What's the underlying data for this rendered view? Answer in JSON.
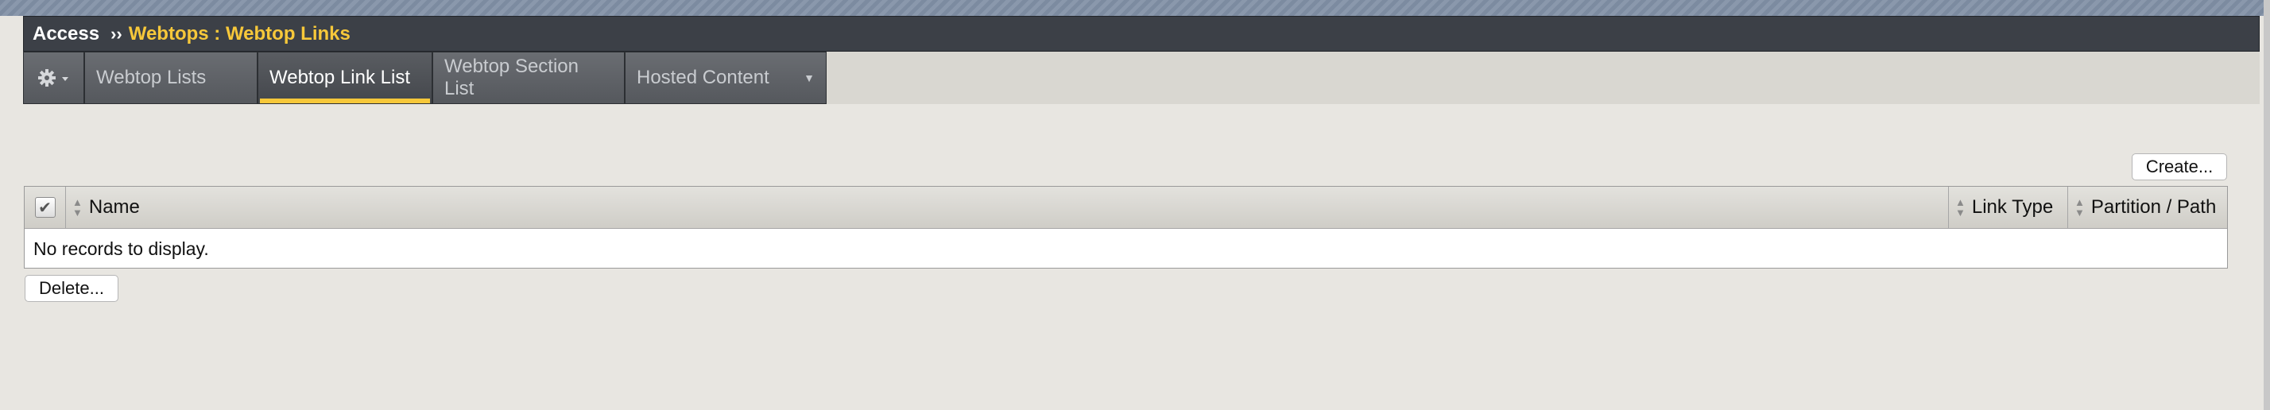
{
  "breadcrumb": {
    "root": "Access",
    "separator": "››",
    "current": "Webtops : Webtop Links"
  },
  "tabs": {
    "gear_icon": "gear-icon",
    "items": [
      {
        "label": "Webtop Lists",
        "active": false
      },
      {
        "label": "Webtop Link List",
        "active": true
      },
      {
        "label": "Webtop Section List",
        "active": false
      },
      {
        "label": "Hosted Content",
        "active": false,
        "has_dropdown": true
      }
    ]
  },
  "actions": {
    "create_label": "Create...",
    "delete_label": "Delete..."
  },
  "table": {
    "columns": [
      "Name",
      "Link Type",
      "Partition / Path"
    ],
    "empty_message": "No records to display."
  },
  "colors": {
    "accent": "#f7c83a",
    "titlebar": "#3c4047",
    "background": "#e8e6e1"
  }
}
